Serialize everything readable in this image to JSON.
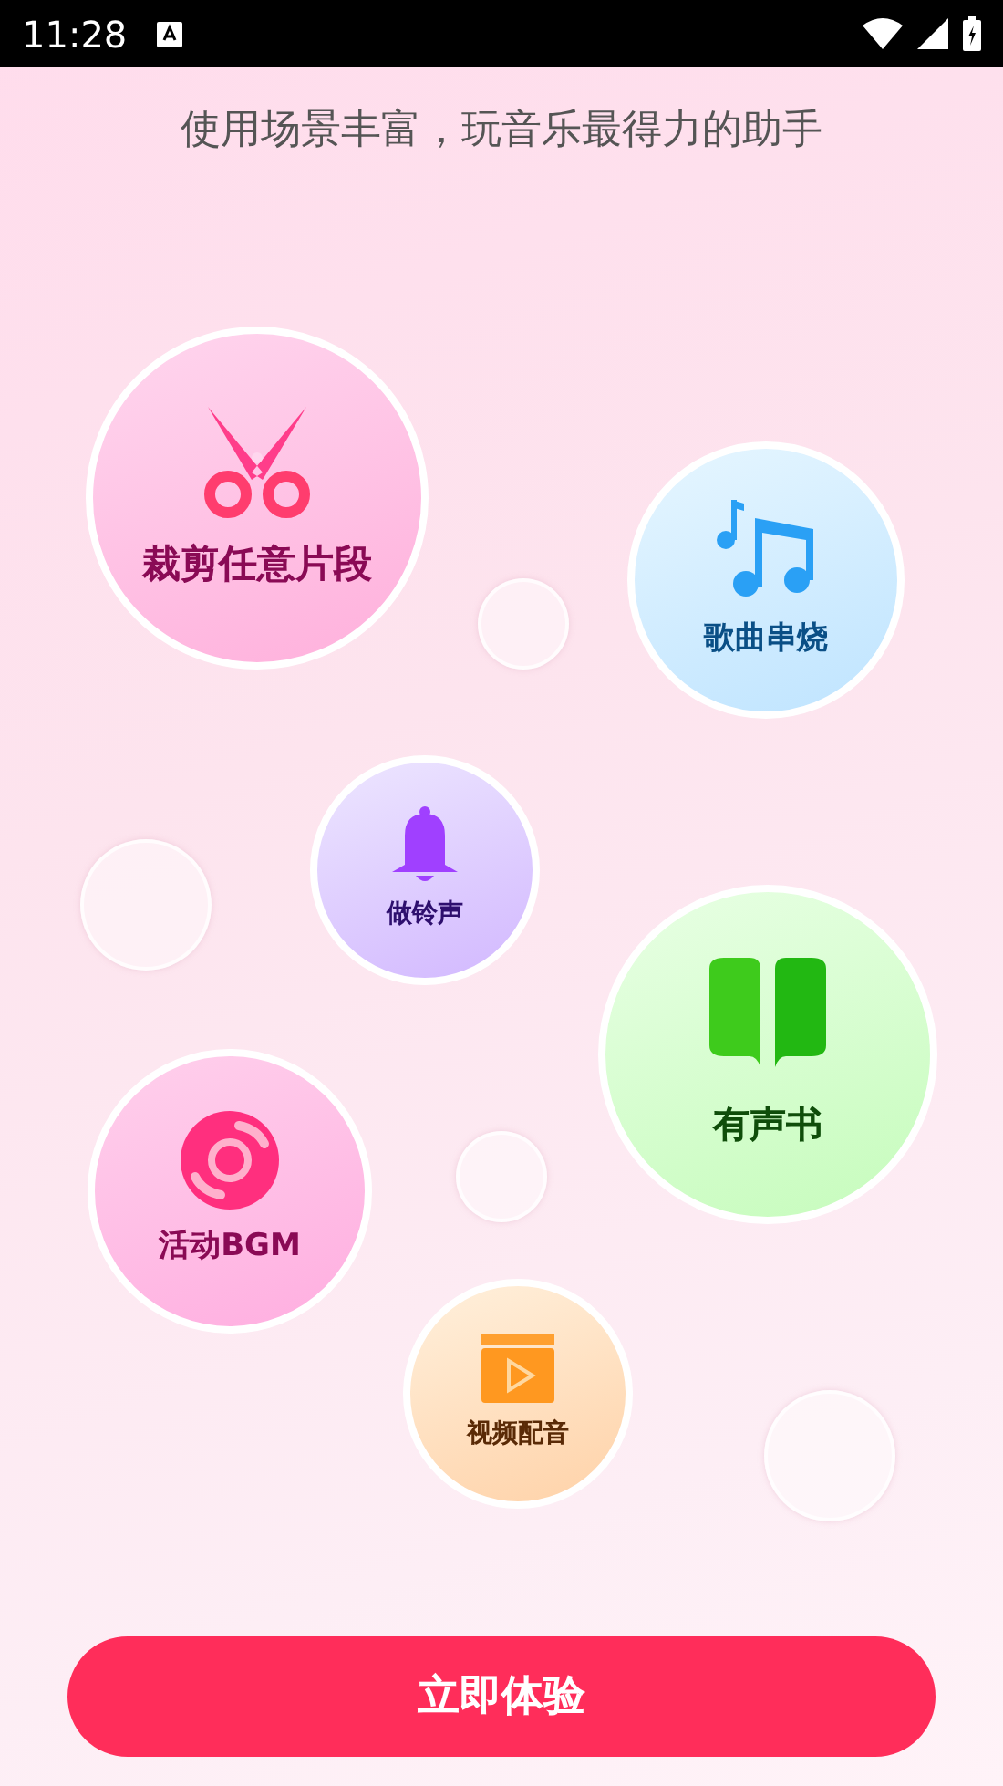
{
  "status_bar": {
    "time": "11:28"
  },
  "headline": "使用场景丰富，玩音乐最得力的助手",
  "features": [
    {
      "kind": "scissors",
      "label": "裁剪任意片段"
    },
    {
      "kind": "music",
      "label": "歌曲串烧"
    },
    {
      "kind": "bell",
      "label": "做铃声"
    },
    {
      "kind": "book",
      "label": "有声书"
    },
    {
      "kind": "disc",
      "label": "活动BGM"
    },
    {
      "kind": "film",
      "label": "视频配音"
    }
  ],
  "primary_button": "立即体验"
}
